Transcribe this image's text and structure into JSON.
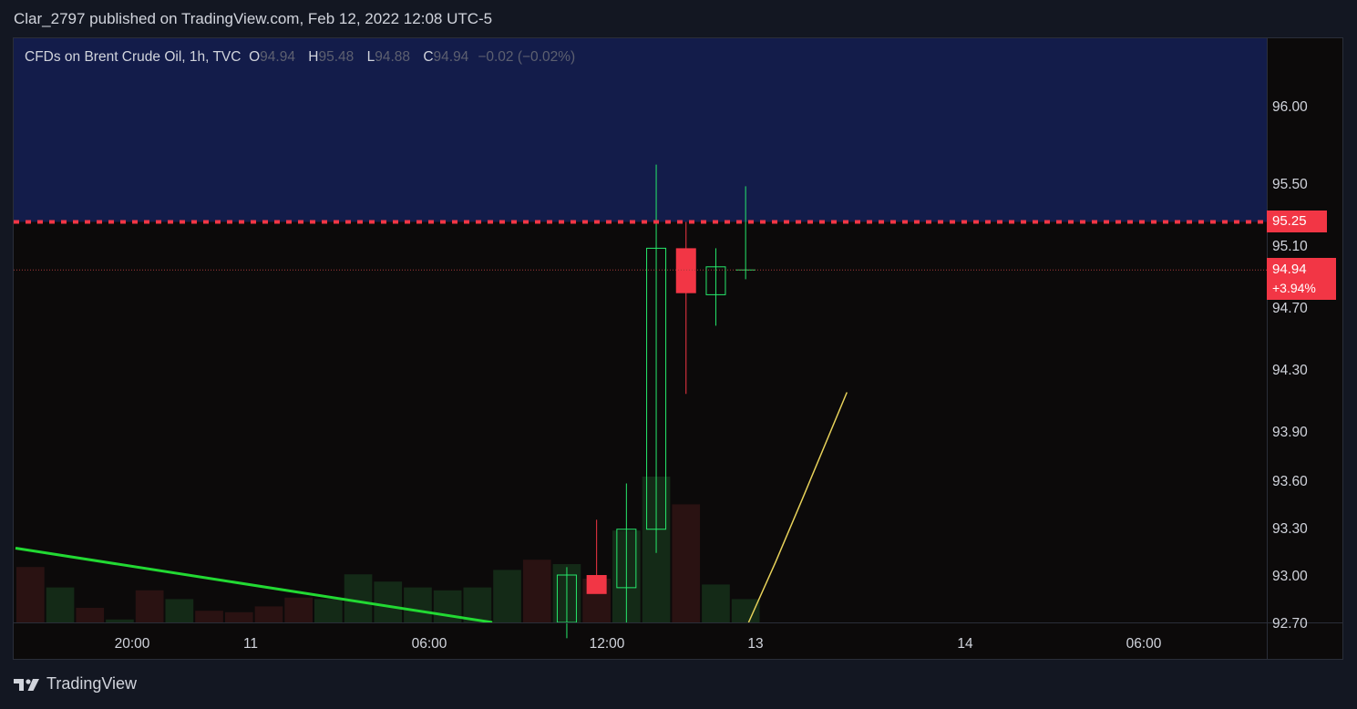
{
  "header": {
    "title": "Clar_2797 published on TradingView.com, Feb 12, 2022 12:08 UTC-5"
  },
  "legend": {
    "symbol": "CFDs on Brent Crude Oil, 1h, TVC",
    "o_label": "O",
    "o_value": "94.94",
    "h_label": "H",
    "h_value": "95.48",
    "l_label": "L",
    "l_value": "94.88",
    "c_label": "C",
    "c_value": "94.94",
    "change": "−0.02 (−0.02%)"
  },
  "price_labels": {
    "resistance": "95.25",
    "last_price": "94.94",
    "last_change": "+3.94%"
  },
  "footer": {
    "brand": "TradingView"
  },
  "colors": {
    "up": "#26e86b",
    "down": "#f23645",
    "zone": "#131c4a",
    "background": "#0c0a0a",
    "trendline": "#22d933",
    "ma_line": "#e8d25a"
  },
  "chart_data": {
    "type": "candlestick",
    "y_ticks": [
      96.0,
      95.5,
      95.1,
      94.7,
      94.3,
      93.9,
      93.6,
      93.3,
      93.0,
      92.7
    ],
    "y_tick_labels": [
      "96.00",
      "95.50",
      "95.10",
      "94.70",
      "94.30",
      "93.90",
      "93.60",
      "93.30",
      "93.00",
      "92.70"
    ],
    "x_ticks": [
      "20:00",
      "11",
      "06:00",
      "12:00",
      "13",
      "14",
      "06:00"
    ],
    "candles": [
      {
        "o": 92.7,
        "h": 93.05,
        "l": 92.6,
        "c": 93.0
      },
      {
        "o": 93.0,
        "h": 93.35,
        "l": 92.9,
        "c": 92.88
      },
      {
        "o": 92.92,
        "h": 93.58,
        "l": 92.7,
        "c": 93.29
      },
      {
        "o": 93.29,
        "h": 95.62,
        "l": 93.14,
        "c": 95.08
      },
      {
        "o": 95.08,
        "h": 95.25,
        "l": 94.14,
        "c": 94.79
      },
      {
        "o": 94.78,
        "h": 95.08,
        "l": 94.58,
        "c": 94.96
      },
      {
        "o": 94.94,
        "h": 95.48,
        "l": 94.88,
        "c": 94.94
      }
    ],
    "volume": [
      {
        "v": 0.38,
        "up": false
      },
      {
        "v": 0.24,
        "up": true
      },
      {
        "v": 0.1,
        "up": false
      },
      {
        "v": 0.02,
        "up": true
      },
      {
        "v": 0.22,
        "up": false
      },
      {
        "v": 0.16,
        "up": true
      },
      {
        "v": 0.08,
        "up": false
      },
      {
        "v": 0.07,
        "up": false
      },
      {
        "v": 0.11,
        "up": false
      },
      {
        "v": 0.17,
        "up": false
      },
      {
        "v": 0.16,
        "up": true
      },
      {
        "v": 0.33,
        "up": true
      },
      {
        "v": 0.28,
        "up": true
      },
      {
        "v": 0.24,
        "up": true
      },
      {
        "v": 0.22,
        "up": true
      },
      {
        "v": 0.24,
        "up": true
      },
      {
        "v": 0.36,
        "up": true
      },
      {
        "v": 0.43,
        "up": false
      },
      {
        "v": 0.4,
        "up": true
      },
      {
        "v": 0.3,
        "up": false
      },
      {
        "v": 0.63,
        "up": true
      },
      {
        "v": 1.0,
        "up": true
      },
      {
        "v": 0.81,
        "up": false
      },
      {
        "v": 0.26,
        "up": true
      },
      {
        "v": 0.16,
        "up": true
      }
    ],
    "resistance_level": 95.25,
    "last_price": 94.94,
    "zone": {
      "from": 95.25,
      "to": 96.4
    },
    "trendline": [
      {
        "x": 0,
        "y": 93.17
      },
      {
        "x": 16,
        "y": 92.7
      }
    ],
    "ma_line": [
      {
        "x": 24.6,
        "y": 92.7
      },
      {
        "x": 25.5,
        "y": 93.08
      },
      {
        "x": 26.4,
        "y": 93.48
      },
      {
        "x": 27.9,
        "y": 94.15
      }
    ]
  }
}
